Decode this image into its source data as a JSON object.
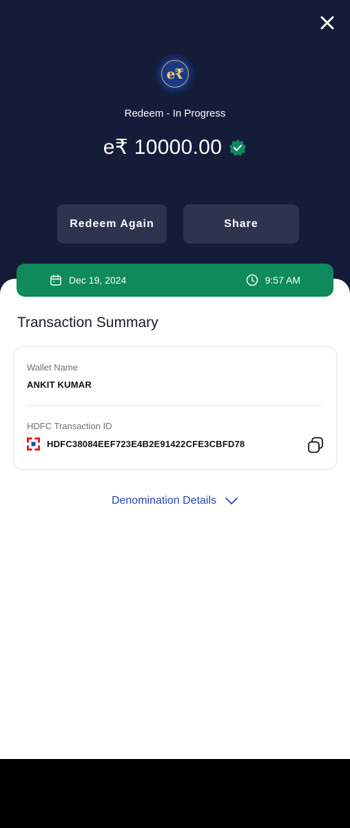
{
  "header": {
    "close_icon": "close-icon",
    "coin_symbol": "e₹",
    "status": "Redeem - In Progress",
    "amount": "e₹ 10000.00",
    "verified_icon": "verified-check-icon",
    "accent": "#0e8a5c",
    "background": "#151c3a"
  },
  "actions": {
    "redeem_again": "Redeem Again",
    "share": "Share"
  },
  "datetime": {
    "date": "Dec 19, 2024",
    "time": "9:57 AM",
    "date_icon": "calendar-icon",
    "time_icon": "clock-icon"
  },
  "summary": {
    "title": "Transaction Summary",
    "wallet_label": "Wallet Name",
    "wallet_value": "ANKIT KUMAR",
    "txn_label": "HDFC Transaction ID",
    "txn_value": "HDFC38084EEF723E4B2E91422CFE3CBFD78",
    "bank_icon": "hdfc-logo-icon",
    "copy_icon": "copy-icon"
  },
  "denomination": {
    "label": "Denomination Details",
    "icon": "chevron-down-icon",
    "color": "#2a44b0"
  }
}
